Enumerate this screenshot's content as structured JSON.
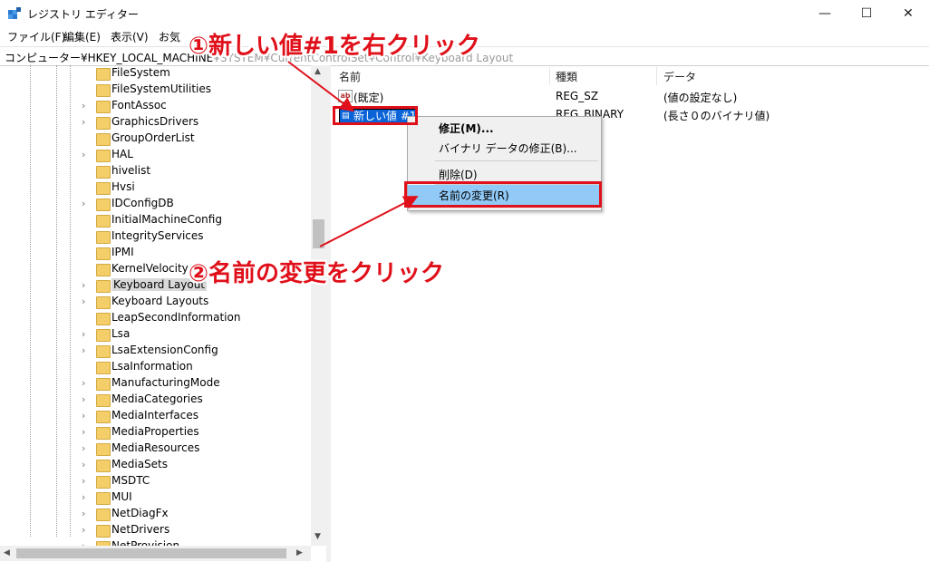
{
  "window": {
    "title": "レジストリ エディター",
    "minimize": "—",
    "maximize": "☐",
    "close": "✕"
  },
  "menu": [
    "ファイル(F)",
    "編集(E)",
    "表示(V)",
    "お気"
  ],
  "address": {
    "prefix": "コンピューター¥HKEY_LOCAL_MACHINE",
    "rest": "¥SYSTEM¥CurrentControlSet¥Control¥Keyboard Layout"
  },
  "tree": {
    "items": [
      {
        "label": "FileSystem",
        "expandable": false
      },
      {
        "label": "FileSystemUtilities",
        "expandable": false
      },
      {
        "label": "FontAssoc",
        "expandable": true
      },
      {
        "label": "GraphicsDrivers",
        "expandable": true
      },
      {
        "label": "GroupOrderList",
        "expandable": false
      },
      {
        "label": "HAL",
        "expandable": true
      },
      {
        "label": "hivelist",
        "expandable": false
      },
      {
        "label": "Hvsi",
        "expandable": false
      },
      {
        "label": "IDConfigDB",
        "expandable": true
      },
      {
        "label": "InitialMachineConfig",
        "expandable": false
      },
      {
        "label": "IntegrityServices",
        "expandable": false
      },
      {
        "label": "IPMI",
        "expandable": false
      },
      {
        "label": "KernelVelocity",
        "expandable": false
      },
      {
        "label": "Keyboard Layout",
        "expandable": true,
        "selected": true
      },
      {
        "label": "Keyboard Layouts",
        "expandable": true
      },
      {
        "label": "LeapSecondInformation",
        "expandable": false
      },
      {
        "label": "Lsa",
        "expandable": true
      },
      {
        "label": "LsaExtensionConfig",
        "expandable": true
      },
      {
        "label": "LsaInformation",
        "expandable": false
      },
      {
        "label": "ManufacturingMode",
        "expandable": true
      },
      {
        "label": "MediaCategories",
        "expandable": true
      },
      {
        "label": "MediaInterfaces",
        "expandable": true
      },
      {
        "label": "MediaProperties",
        "expandable": true
      },
      {
        "label": "MediaResources",
        "expandable": true
      },
      {
        "label": "MediaSets",
        "expandable": true
      },
      {
        "label": "MSDTC",
        "expandable": true
      },
      {
        "label": "MUI",
        "expandable": true
      },
      {
        "label": "NetDiagFx",
        "expandable": true
      },
      {
        "label": "NetDrivers",
        "expandable": true
      },
      {
        "label": "NetProvision",
        "expandable": true
      }
    ]
  },
  "list": {
    "columns": {
      "name": "名前",
      "type": "種類",
      "data": "データ"
    },
    "rows": [
      {
        "name": "(既定)",
        "type": "REG_SZ",
        "data": "(値の設定なし)"
      },
      {
        "name": "新しい値 #1",
        "type": "REG_BINARY",
        "data": "(長さ０のバイナリ値)"
      }
    ]
  },
  "context_menu": {
    "modify": "修正(M)...",
    "modify_binary": "バイナリ データの修正(B)...",
    "delete": "削除(D)",
    "rename": "名前の変更(R)"
  },
  "annotations": {
    "step1": "①新しい値#1を右クリック",
    "step2": "②名前の変更をクリック",
    "accent": "#e0101a"
  },
  "colors": {
    "selection": "#0a64d8",
    "menu_highlight": "#91c9f7",
    "folder": "#f4cf69"
  }
}
